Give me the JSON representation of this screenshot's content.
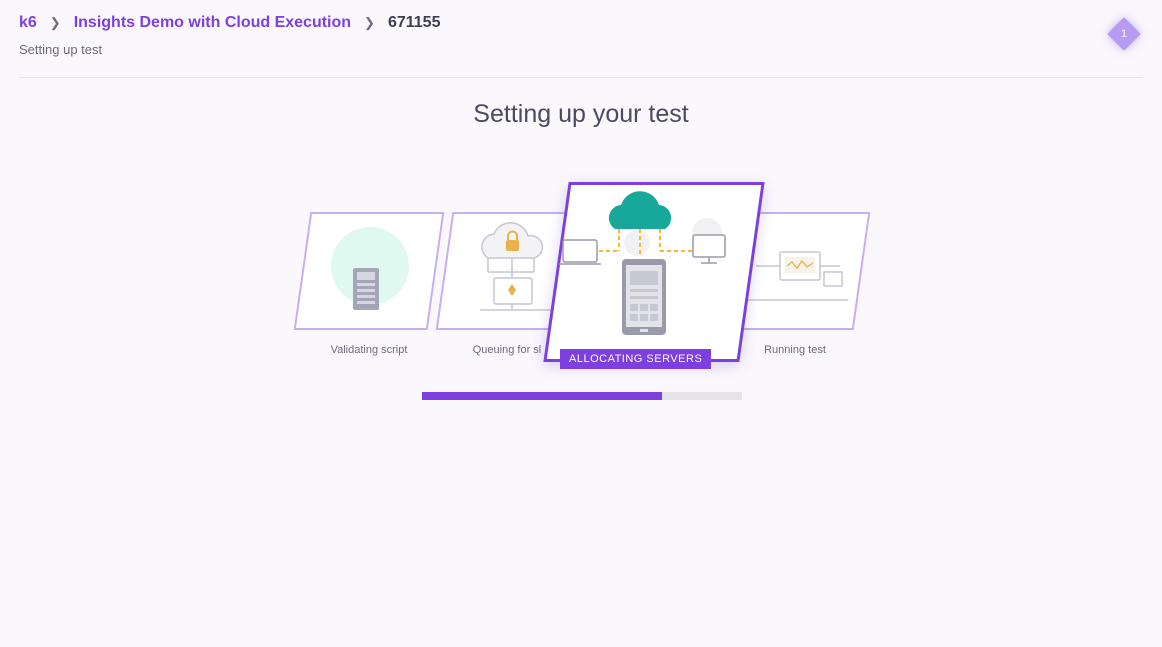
{
  "breadcrumb": {
    "root": "k6",
    "project": "Insights Demo with Cloud Execution",
    "run_id": "671155"
  },
  "subtitle": "Setting up test",
  "notification_count": "1",
  "main_title": "Setting up your test",
  "steps": [
    {
      "label": "Validating script",
      "state": "done"
    },
    {
      "label": "Queuing for sl",
      "state": "done"
    },
    {
      "label": "ALLOCATING SERVERS",
      "state": "active"
    },
    {
      "label": "Running test",
      "state": "pending"
    }
  ],
  "progress": 0.75,
  "colors": {
    "accent": "#7d3fe0",
    "accent_light": "#c7aef3",
    "teal": "#17a89a",
    "mint": "#dff8f0",
    "dash": "#f5b82e"
  }
}
